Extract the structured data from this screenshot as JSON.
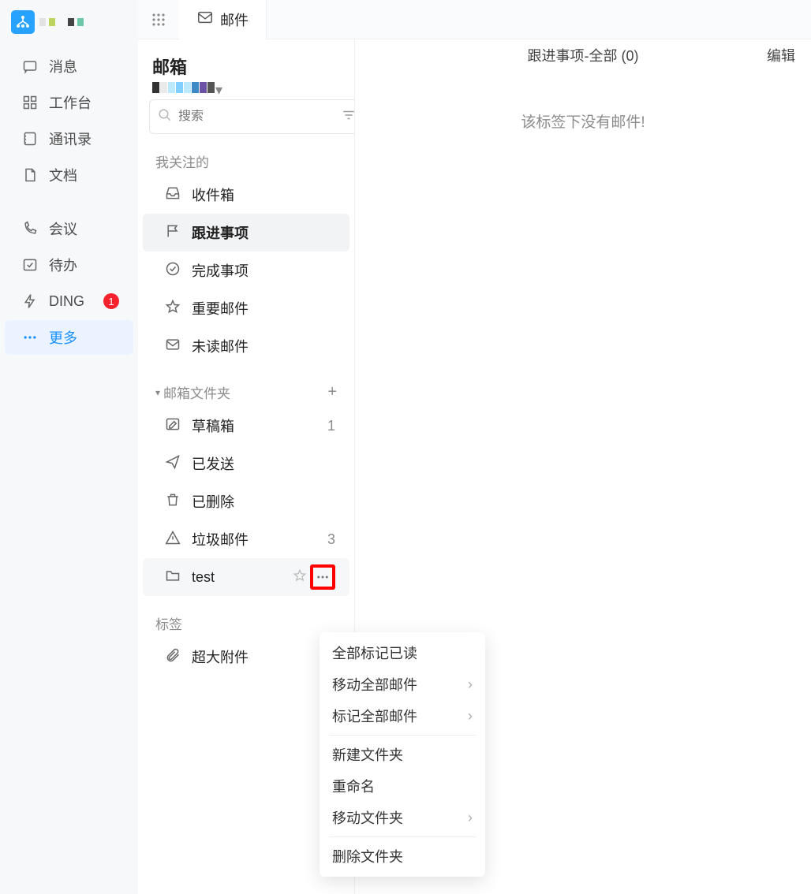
{
  "leftRail": {
    "items": [
      {
        "label": "消息"
      },
      {
        "label": "工作台"
      },
      {
        "label": "通讯录"
      },
      {
        "label": "文档"
      },
      {
        "label": "会议"
      },
      {
        "label": "待办"
      },
      {
        "label": "DING",
        "badge": "1"
      },
      {
        "label": "更多"
      }
    ]
  },
  "topbar": {
    "tab_label": "邮件"
  },
  "mailSide": {
    "title": "邮箱",
    "search_placeholder": "搜索",
    "sections": {
      "focus_header": "我关注的",
      "folders_header": "邮箱文件夹",
      "tags_header": "标签"
    },
    "focus": [
      {
        "label": "收件箱"
      },
      {
        "label": "跟进事项"
      },
      {
        "label": "完成事项"
      },
      {
        "label": "重要邮件"
      },
      {
        "label": "未读邮件"
      }
    ],
    "folders": [
      {
        "label": "草稿箱",
        "count": "1"
      },
      {
        "label": "已发送"
      },
      {
        "label": "已删除"
      },
      {
        "label": "垃圾邮件",
        "count": "3"
      },
      {
        "label": "test"
      }
    ],
    "attachments": {
      "label": "超大附件"
    }
  },
  "main": {
    "header": "跟进事项-全部 (0)",
    "edit": "编辑",
    "empty": "该标签下没有邮件!"
  },
  "ctx": {
    "mark_all_read": "全部标记已读",
    "move_all": "移动全部邮件",
    "tag_all": "标记全部邮件",
    "new_folder": "新建文件夹",
    "rename": "重命名",
    "move_folder": "移动文件夹",
    "delete_folder": "删除文件夹"
  }
}
